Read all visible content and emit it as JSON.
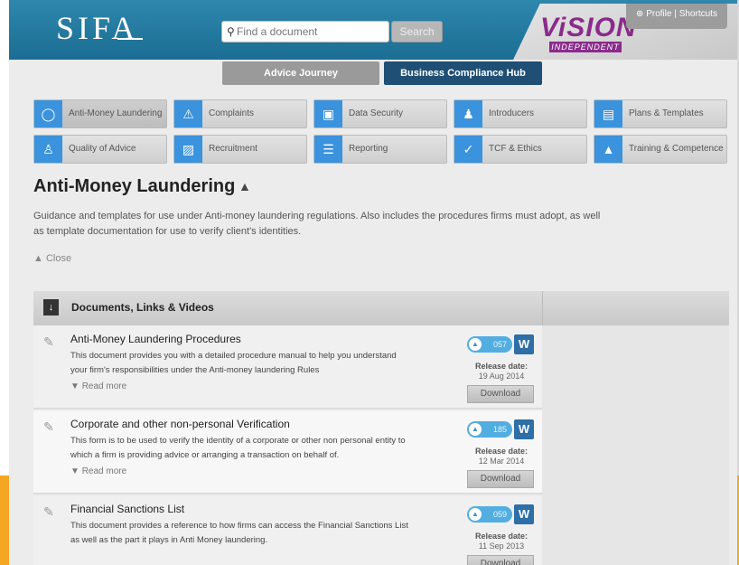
{
  "header": {
    "logo": "SIFA",
    "search_placeholder": "Find a document",
    "search_button": "Search",
    "brand_main": "ViSION",
    "brand_sub": "INDEPENDENT",
    "profile_label": "Profile | Shortcuts"
  },
  "nav": {
    "tabs": [
      "Advice Journey",
      "Business Compliance Hub"
    ]
  },
  "categories": [
    {
      "label": "Anti-Money Laundering",
      "icon": "circle-icon"
    },
    {
      "label": "Complaints",
      "icon": "warning-icon"
    },
    {
      "label": "Data Security",
      "icon": "lock-icon"
    },
    {
      "label": "Introducers",
      "icon": "people-icon"
    },
    {
      "label": "Plans & Templates",
      "icon": "document-stack-icon"
    },
    {
      "label": "Quality of Advice",
      "icon": "person-icon"
    },
    {
      "label": "Recruitment",
      "icon": "id-card-icon"
    },
    {
      "label": "Reporting",
      "icon": "report-icon"
    },
    {
      "label": "TCF & Ethics",
      "icon": "check-icon"
    },
    {
      "label": "Training & Competence",
      "icon": "graduation-cap-icon"
    }
  ],
  "section": {
    "title": "Anti-Money Laundering",
    "description": "Guidance and templates for use under Anti-money laundering regulations. Also includes the procedures firms must adopt, as well as template documentation for use to verify client's identities.",
    "close_label": "Close"
  },
  "docs_panel": {
    "heading": "Documents, Links & Videos",
    "release_label": "Release date:",
    "download_label": "Download",
    "read_more_label": "Read more",
    "items": [
      {
        "title": "Anti-Money Laundering Procedures",
        "body": "This document provides you with a detailed procedure manual to help you understand your firm's responsibilities under the Anti-money laundering Rules",
        "count": "057",
        "date": "19 Aug 2014",
        "read_more": true
      },
      {
        "title": "Corporate and other non-personal Verification",
        "body": "This form is to be used to verify the identity of a corporate or other non personal entity to which a firm is providing advice or arranging a transaction on behalf of.",
        "count": "185",
        "date": "12 Mar 2014",
        "read_more": true
      },
      {
        "title": "Financial Sanctions List",
        "body": "This document provides a reference to how firms can access the Financial Sanctions List as well as the part it plays in Anti Money laundering.",
        "count": "059",
        "date": "11 Sep 2013",
        "read_more": false
      }
    ]
  },
  "colors": {
    "header_blue": "#1b6d93",
    "tab_active": "#1f4f74",
    "icon_blue": "#3a93dc",
    "brand_purple": "#8a2b8c",
    "accent_orange": "#f5a623"
  }
}
